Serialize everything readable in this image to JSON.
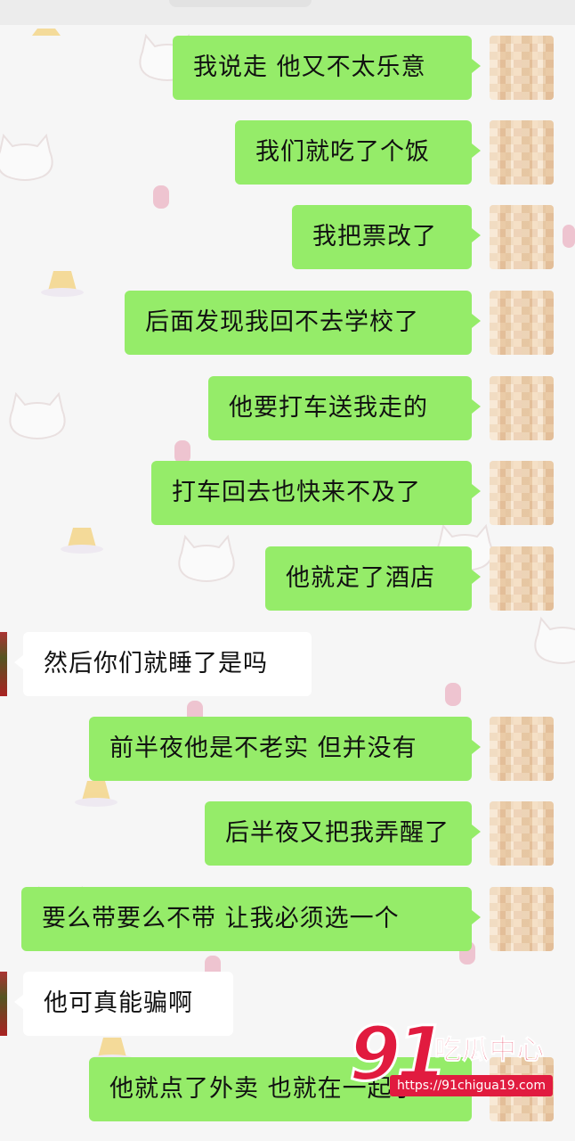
{
  "messages": [
    {
      "side": "right",
      "text": "我说走 他又不太乐意"
    },
    {
      "side": "right",
      "text": "我们就吃了个饭"
    },
    {
      "side": "right",
      "text": "我把票改了"
    },
    {
      "side": "right",
      "text": "后面发现我回不去学校了"
    },
    {
      "side": "right",
      "text": "他要打车送我走的"
    },
    {
      "side": "right",
      "text": "打车回去也快来不及了"
    },
    {
      "side": "right",
      "text": "他就定了酒店"
    },
    {
      "side": "left",
      "text": "然后你们就睡了是吗"
    },
    {
      "side": "right",
      "text": "前半夜他是不老实 但并没有"
    },
    {
      "side": "right",
      "text": "后半夜又把我弄醒了"
    },
    {
      "side": "right",
      "text": "要么带要么不带 让我必须选一个"
    },
    {
      "side": "left",
      "text": "他可真能骗啊"
    },
    {
      "side": "right",
      "text": "他就点了外卖 也就在一起了"
    }
  ],
  "watermark": {
    "number": "91",
    "title": "吃瓜中心",
    "url": "https://91chigua19.com"
  },
  "colors": {
    "sent_bubble": "#95ec69",
    "received_bubble": "#ffffff",
    "background": "#f6f6f6",
    "watermark": "#e11b3f"
  }
}
